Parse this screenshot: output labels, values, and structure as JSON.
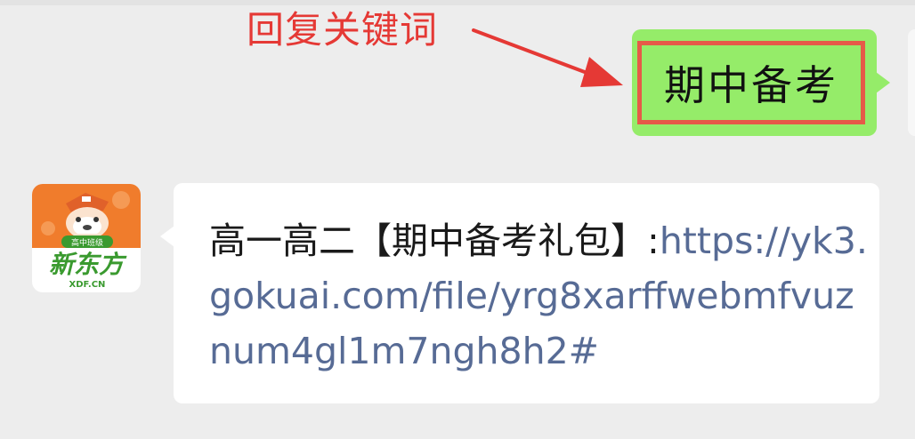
{
  "annotation": {
    "label": "回复关键词",
    "color": "#e53935"
  },
  "outgoing_message": {
    "text": "期中备考",
    "bubble_color": "#95ec69",
    "highlight_color": "#e65a48"
  },
  "incoming_message": {
    "prefix": "高一高二【期中备考礼包】:",
    "link": "https://yk3.gokuai.com/file/yrg8xarffwebmfvuznum4gl1m7ngh8h2#",
    "link_color": "#576b95",
    "sender_avatar": {
      "badge": "高中班级",
      "brand": "新东方",
      "domain": "XDF.CN",
      "icon": "new-oriental-logo-icon"
    }
  },
  "colors": {
    "background": "#ededed",
    "brand_orange": "#f07c2c",
    "brand_green": "#3a9a2f"
  }
}
